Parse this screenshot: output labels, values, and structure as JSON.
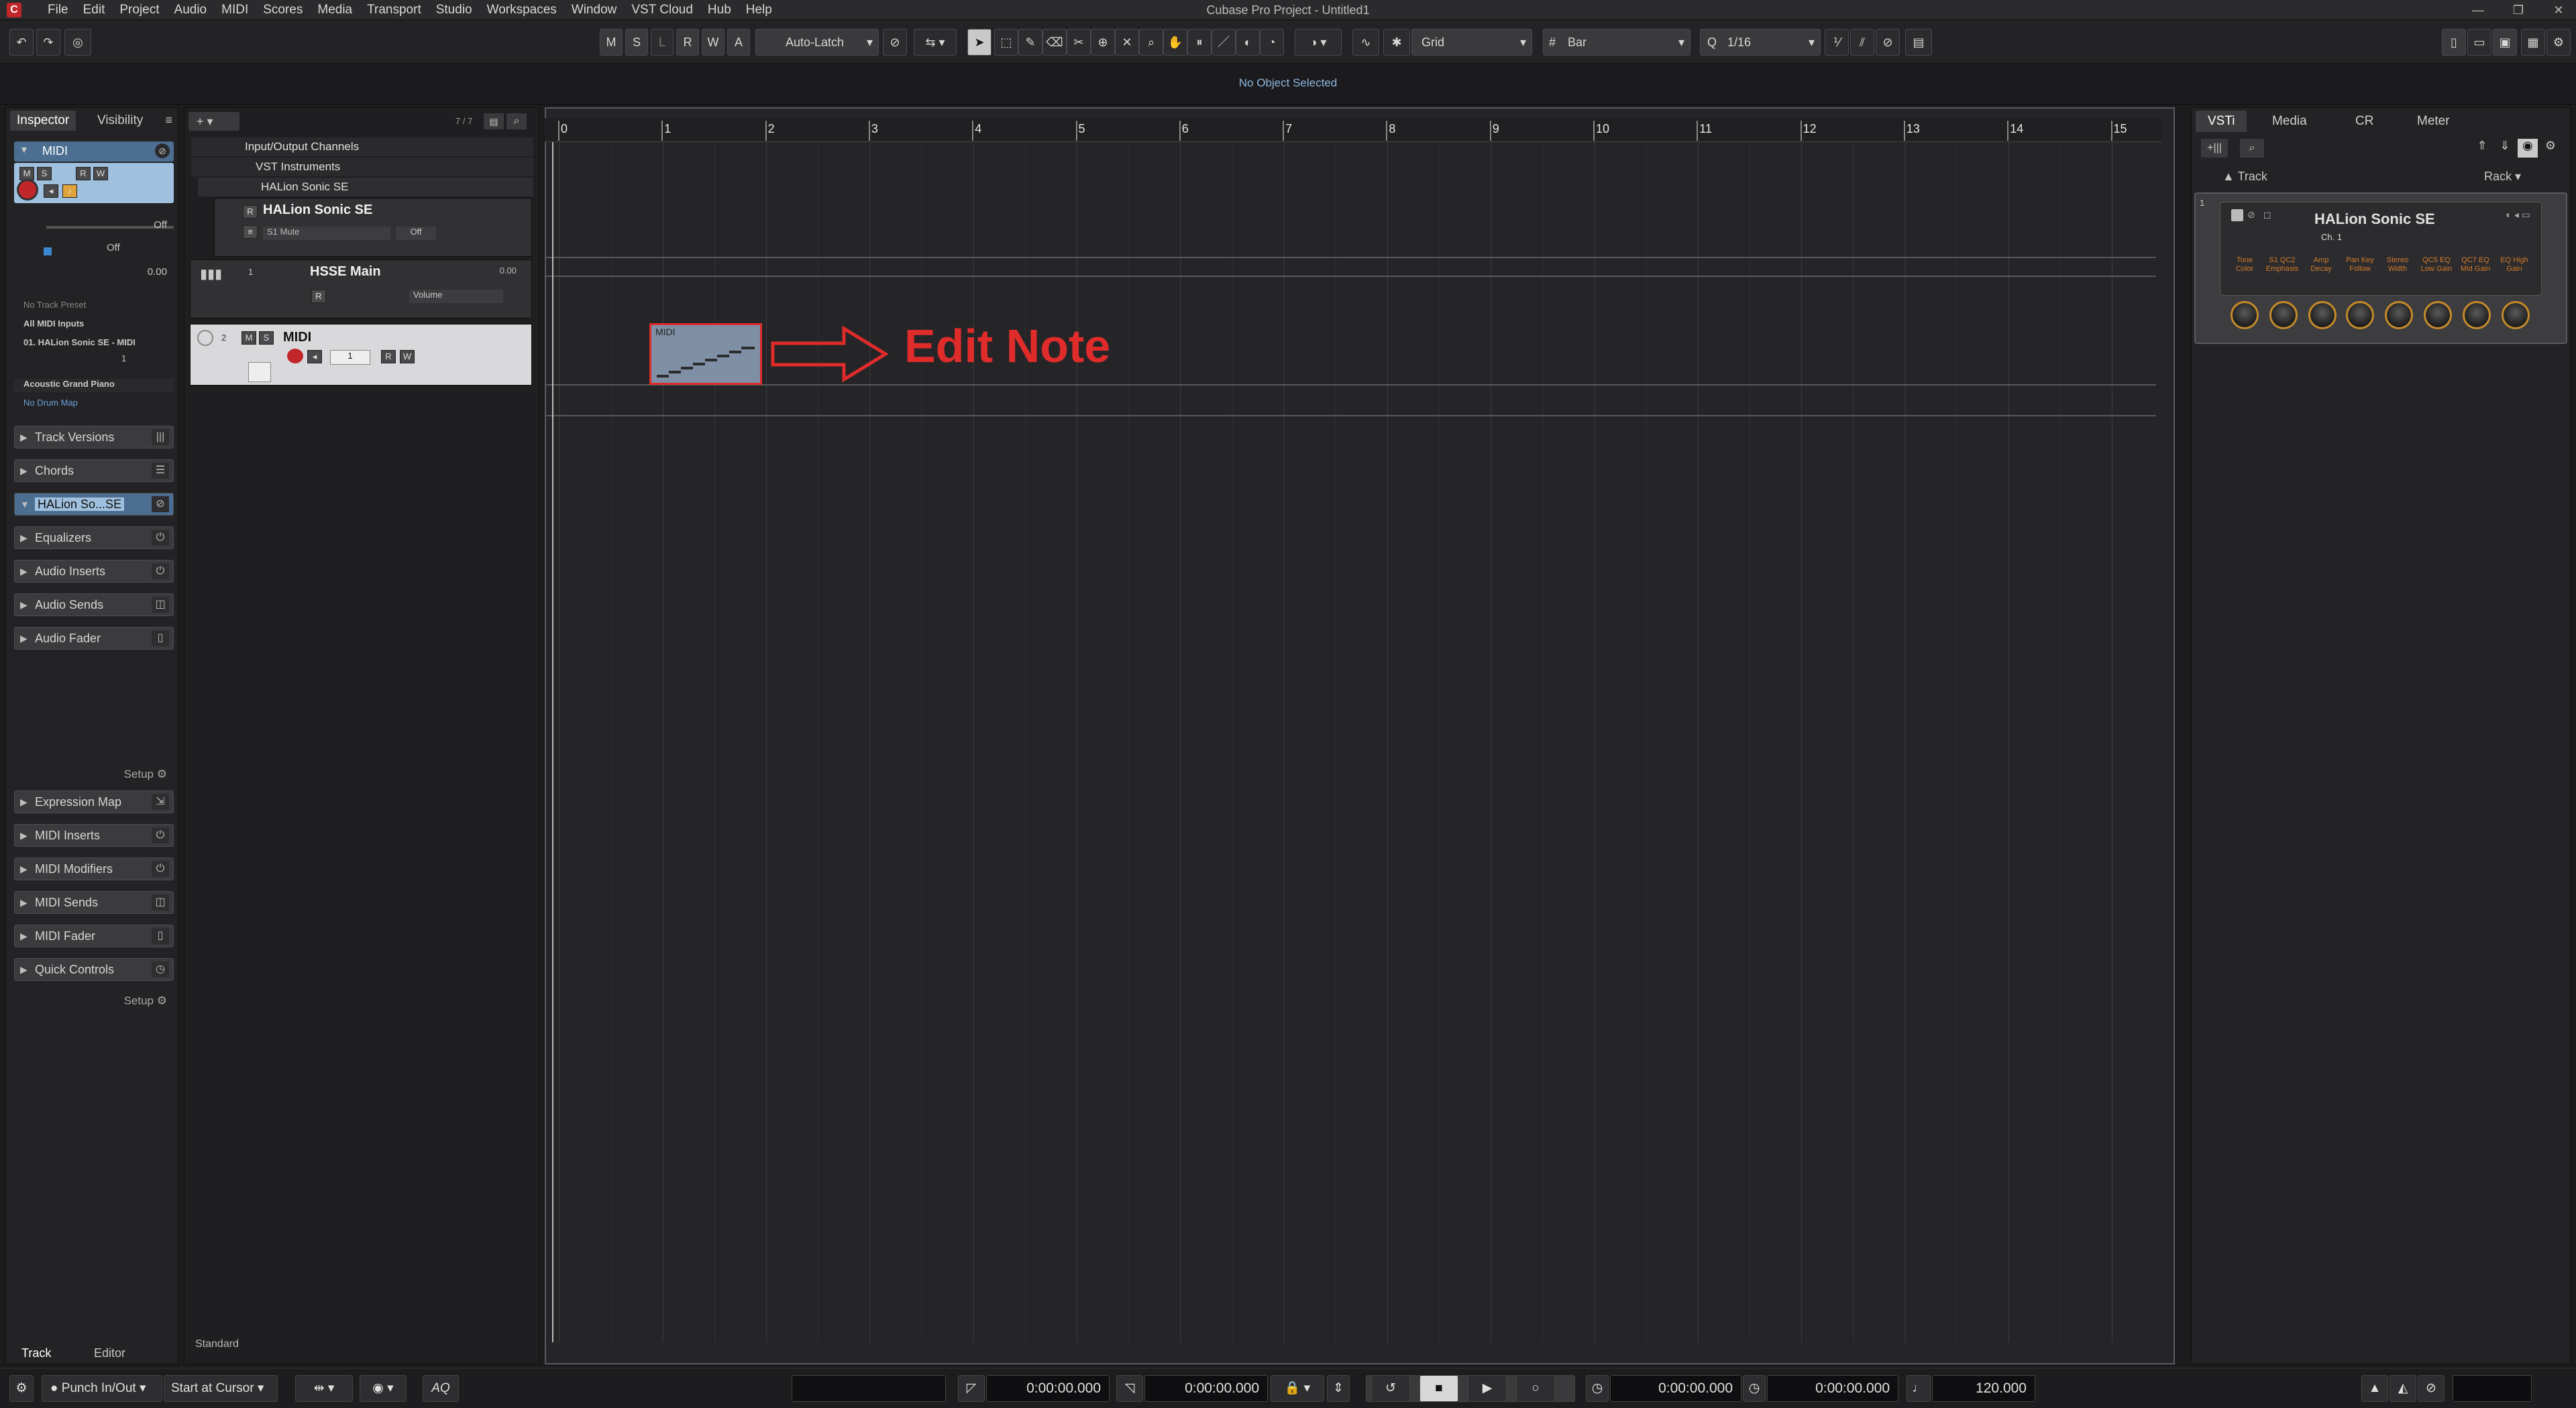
{
  "app": {
    "title": "Cubase Pro Project - Untitled1",
    "menu": [
      "File",
      "Edit",
      "Project",
      "Audio",
      "MIDI",
      "Scores",
      "Media",
      "Transport",
      "Studio",
      "Workspaces",
      "Window",
      "VST Cloud",
      "Hub",
      "Help"
    ]
  },
  "toolbar": {
    "state_buttons": [
      "M",
      "S",
      "L",
      "R",
      "W",
      "A"
    ],
    "automation_mode": "Auto-Latch",
    "snap_mode": "Grid",
    "grid_type": "Bar",
    "quantize": "1/16"
  },
  "info_line": {
    "status": "No Object Selected"
  },
  "inspector": {
    "tabs": [
      "Inspector",
      "Visibility"
    ],
    "track_name": "MIDI",
    "state_buttons": [
      "M",
      "S",
      "R",
      "W"
    ],
    "fader_values": [
      "Off",
      "Off",
      "0.00"
    ],
    "track_preset": "No Track Preset",
    "input": "All MIDI Inputs",
    "output": "01. HALion Sonic SE - MIDI",
    "channel": "1",
    "program": "Acoustic Grand Piano",
    "drum_map": "No Drum Map",
    "sections": [
      "Track Versions",
      "Chords",
      "HALion So...SE",
      "Equalizers",
      "Audio Inserts",
      "Audio Sends",
      "Audio Fader",
      "Expression Map",
      "MIDI Inserts",
      "MIDI Modifiers",
      "MIDI Sends",
      "MIDI Fader",
      "Quick Controls"
    ],
    "setup_label": "Setup",
    "bottom_tabs": [
      "Track",
      "Editor"
    ]
  },
  "track_list": {
    "counter": "7 / 7",
    "folders": [
      "Input/Output Channels",
      "VST Instruments",
      "HALion Sonic SE"
    ],
    "tracks": [
      {
        "name": "HALion Sonic SE",
        "sub": "S1 Mute",
        "value": "Off"
      },
      {
        "name": "HSSE Main",
        "number": "1",
        "value": "Volume",
        "level": "0.00"
      },
      {
        "name": "MIDI",
        "number": "2",
        "channel": "1"
      }
    ],
    "footer": "Standard"
  },
  "ruler": {
    "bars": [
      "0",
      "1",
      "2",
      "3",
      "4",
      "5",
      "6",
      "7",
      "8",
      "9",
      "10",
      "11",
      "12",
      "13",
      "14",
      "15"
    ]
  },
  "event": {
    "label": "MIDI"
  },
  "annotation": {
    "text": "Edit Note",
    "color": "#e02b2b"
  },
  "right_zone": {
    "tabs": [
      "VSTi",
      "Media",
      "CR",
      "Meter"
    ],
    "track_label": "Track",
    "rack_label": "Rack",
    "slot": "1",
    "instrument": "HALion Sonic SE",
    "channel": "Ch. 1",
    "quick_controls": [
      [
        "Tone",
        "Color"
      ],
      [
        "S1 QC2",
        "Emphasis"
      ],
      [
        "Amp",
        "Decay"
      ],
      [
        "Pan Key",
        "Follow"
      ],
      [
        "Stereo",
        "Width"
      ],
      [
        "QC5 EQ",
        "Low Gain"
      ],
      [
        "QC7 EQ",
        "Mid Gain"
      ],
      [
        "EQ High",
        "Gain"
      ]
    ]
  },
  "transport": {
    "punch": "Punch In/Out",
    "start_mode": "Start at Cursor",
    "aq": "AQ",
    "time_left": "0:00:00.000",
    "time_right": "0:00:00.000",
    "time_pos1": "0:00:00.000",
    "time_pos2": "0:00:00.000",
    "tempo": "120.000"
  },
  "colors": {
    "accent_red": "#e02b2b",
    "record_red": "#c0262a",
    "highlight_blue": "#8fb7e0"
  }
}
